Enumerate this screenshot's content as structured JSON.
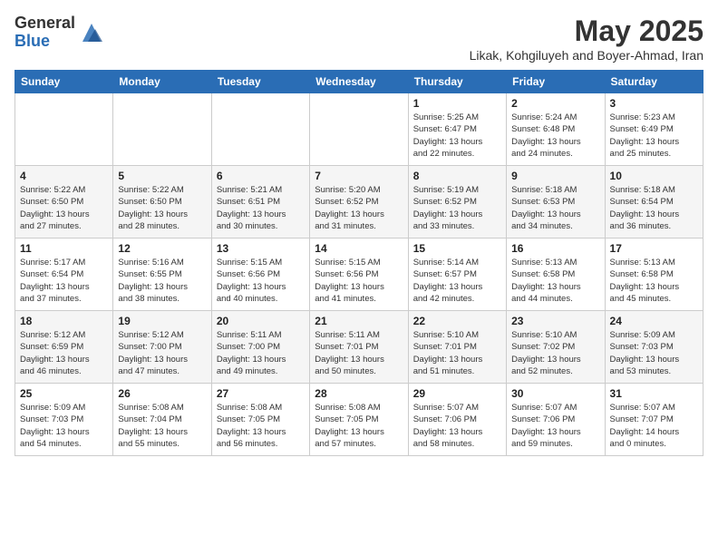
{
  "header": {
    "logo_general": "General",
    "logo_blue": "Blue",
    "month_year": "May 2025",
    "location": "Likak, Kohgiluyeh and Boyer-Ahmad, Iran"
  },
  "days_of_week": [
    "Sunday",
    "Monday",
    "Tuesday",
    "Wednesday",
    "Thursday",
    "Friday",
    "Saturday"
  ],
  "weeks": [
    [
      {
        "day": "",
        "info": ""
      },
      {
        "day": "",
        "info": ""
      },
      {
        "day": "",
        "info": ""
      },
      {
        "day": "",
        "info": ""
      },
      {
        "day": "1",
        "info": "Sunrise: 5:25 AM\nSunset: 6:47 PM\nDaylight: 13 hours\nand 22 minutes."
      },
      {
        "day": "2",
        "info": "Sunrise: 5:24 AM\nSunset: 6:48 PM\nDaylight: 13 hours\nand 24 minutes."
      },
      {
        "day": "3",
        "info": "Sunrise: 5:23 AM\nSunset: 6:49 PM\nDaylight: 13 hours\nand 25 minutes."
      }
    ],
    [
      {
        "day": "4",
        "info": "Sunrise: 5:22 AM\nSunset: 6:50 PM\nDaylight: 13 hours\nand 27 minutes."
      },
      {
        "day": "5",
        "info": "Sunrise: 5:22 AM\nSunset: 6:50 PM\nDaylight: 13 hours\nand 28 minutes."
      },
      {
        "day": "6",
        "info": "Sunrise: 5:21 AM\nSunset: 6:51 PM\nDaylight: 13 hours\nand 30 minutes."
      },
      {
        "day": "7",
        "info": "Sunrise: 5:20 AM\nSunset: 6:52 PM\nDaylight: 13 hours\nand 31 minutes."
      },
      {
        "day": "8",
        "info": "Sunrise: 5:19 AM\nSunset: 6:52 PM\nDaylight: 13 hours\nand 33 minutes."
      },
      {
        "day": "9",
        "info": "Sunrise: 5:18 AM\nSunset: 6:53 PM\nDaylight: 13 hours\nand 34 minutes."
      },
      {
        "day": "10",
        "info": "Sunrise: 5:18 AM\nSunset: 6:54 PM\nDaylight: 13 hours\nand 36 minutes."
      }
    ],
    [
      {
        "day": "11",
        "info": "Sunrise: 5:17 AM\nSunset: 6:54 PM\nDaylight: 13 hours\nand 37 minutes."
      },
      {
        "day": "12",
        "info": "Sunrise: 5:16 AM\nSunset: 6:55 PM\nDaylight: 13 hours\nand 38 minutes."
      },
      {
        "day": "13",
        "info": "Sunrise: 5:15 AM\nSunset: 6:56 PM\nDaylight: 13 hours\nand 40 minutes."
      },
      {
        "day": "14",
        "info": "Sunrise: 5:15 AM\nSunset: 6:56 PM\nDaylight: 13 hours\nand 41 minutes."
      },
      {
        "day": "15",
        "info": "Sunrise: 5:14 AM\nSunset: 6:57 PM\nDaylight: 13 hours\nand 42 minutes."
      },
      {
        "day": "16",
        "info": "Sunrise: 5:13 AM\nSunset: 6:58 PM\nDaylight: 13 hours\nand 44 minutes."
      },
      {
        "day": "17",
        "info": "Sunrise: 5:13 AM\nSunset: 6:58 PM\nDaylight: 13 hours\nand 45 minutes."
      }
    ],
    [
      {
        "day": "18",
        "info": "Sunrise: 5:12 AM\nSunset: 6:59 PM\nDaylight: 13 hours\nand 46 minutes."
      },
      {
        "day": "19",
        "info": "Sunrise: 5:12 AM\nSunset: 7:00 PM\nDaylight: 13 hours\nand 47 minutes."
      },
      {
        "day": "20",
        "info": "Sunrise: 5:11 AM\nSunset: 7:00 PM\nDaylight: 13 hours\nand 49 minutes."
      },
      {
        "day": "21",
        "info": "Sunrise: 5:11 AM\nSunset: 7:01 PM\nDaylight: 13 hours\nand 50 minutes."
      },
      {
        "day": "22",
        "info": "Sunrise: 5:10 AM\nSunset: 7:01 PM\nDaylight: 13 hours\nand 51 minutes."
      },
      {
        "day": "23",
        "info": "Sunrise: 5:10 AM\nSunset: 7:02 PM\nDaylight: 13 hours\nand 52 minutes."
      },
      {
        "day": "24",
        "info": "Sunrise: 5:09 AM\nSunset: 7:03 PM\nDaylight: 13 hours\nand 53 minutes."
      }
    ],
    [
      {
        "day": "25",
        "info": "Sunrise: 5:09 AM\nSunset: 7:03 PM\nDaylight: 13 hours\nand 54 minutes."
      },
      {
        "day": "26",
        "info": "Sunrise: 5:08 AM\nSunset: 7:04 PM\nDaylight: 13 hours\nand 55 minutes."
      },
      {
        "day": "27",
        "info": "Sunrise: 5:08 AM\nSunset: 7:05 PM\nDaylight: 13 hours\nand 56 minutes."
      },
      {
        "day": "28",
        "info": "Sunrise: 5:08 AM\nSunset: 7:05 PM\nDaylight: 13 hours\nand 57 minutes."
      },
      {
        "day": "29",
        "info": "Sunrise: 5:07 AM\nSunset: 7:06 PM\nDaylight: 13 hours\nand 58 minutes."
      },
      {
        "day": "30",
        "info": "Sunrise: 5:07 AM\nSunset: 7:06 PM\nDaylight: 13 hours\nand 59 minutes."
      },
      {
        "day": "31",
        "info": "Sunrise: 5:07 AM\nSunset: 7:07 PM\nDaylight: 14 hours\nand 0 minutes."
      }
    ]
  ]
}
